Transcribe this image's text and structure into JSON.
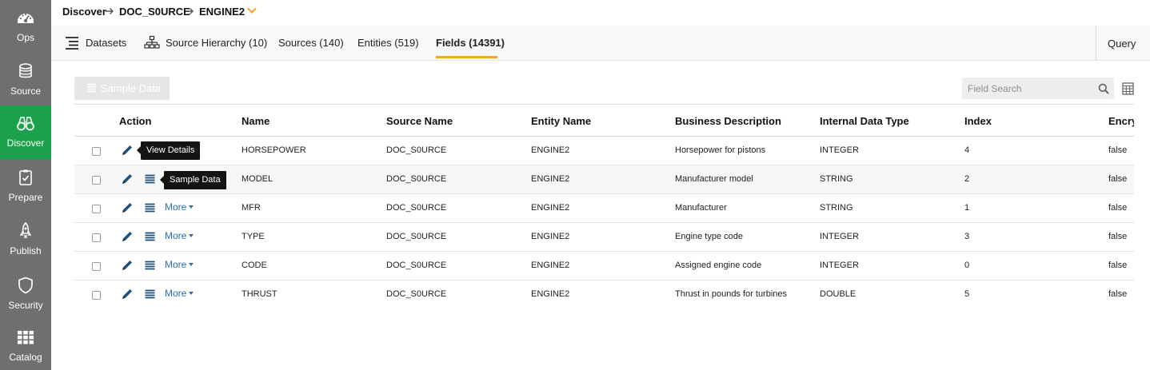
{
  "sidebar": {
    "items": [
      {
        "label": "Ops",
        "icon": "gauge-icon",
        "active": false
      },
      {
        "label": "Source",
        "icon": "database-icon",
        "active": false
      },
      {
        "label": "Discover",
        "icon": "binoculars-icon",
        "active": true
      },
      {
        "label": "Prepare",
        "icon": "clipboard-icon",
        "active": false
      },
      {
        "label": "Publish",
        "icon": "rocket-icon",
        "active": false
      },
      {
        "label": "Security",
        "icon": "shield-icon",
        "active": false
      },
      {
        "label": "Catalog",
        "icon": "grid-icon",
        "active": false
      }
    ],
    "background": "#6f6f6f",
    "active_color": "#1aa34a"
  },
  "breadcrumb": {
    "items": [
      "Discover",
      "DOC_S0URCE",
      "ENGINE2"
    ],
    "caret_color": "#f5a623"
  },
  "tabs": {
    "items": [
      {
        "label": "Datasets",
        "icon": "list-icon"
      },
      {
        "label": "Source Hierarchy (10)",
        "icon": "hierarchy-icon"
      },
      {
        "label": "Sources (140)"
      },
      {
        "label": "Entities (519)"
      },
      {
        "label": "Fields (14391)",
        "active": true
      }
    ],
    "query_label": "Query",
    "underline_color": "#f5a623"
  },
  "toolbar": {
    "sample_data_label": "Sample Data",
    "search_placeholder": "Field Search"
  },
  "table": {
    "columns": [
      "Action",
      "Name",
      "Source Name",
      "Entity Name",
      "Business Description",
      "Internal Data Type",
      "Index",
      "Encry"
    ],
    "more_label": "More",
    "rows": [
      {
        "name": "HORSEPOWER",
        "source": "DOC_S0URCE",
        "entity": "ENGINE2",
        "description": "Horsepower for pistons",
        "type": "INTEGER",
        "index": "4",
        "encrypted": "false"
      },
      {
        "name": "MODEL",
        "source": "DOC_S0URCE",
        "entity": "ENGINE2",
        "description": "Manufacturer model",
        "type": "STRING",
        "index": "2",
        "encrypted": "false"
      },
      {
        "name": "MFR",
        "source": "DOC_S0URCE",
        "entity": "ENGINE2",
        "description": "Manufacturer",
        "type": "STRING",
        "index": "1",
        "encrypted": "false"
      },
      {
        "name": "TYPE",
        "source": "DOC_S0URCE",
        "entity": "ENGINE2",
        "description": "Engine type code",
        "type": "INTEGER",
        "index": "3",
        "encrypted": "false"
      },
      {
        "name": "CODE",
        "source": "DOC_S0URCE",
        "entity": "ENGINE2",
        "description": "Assigned engine code",
        "type": "INTEGER",
        "index": "0",
        "encrypted": "false"
      },
      {
        "name": "THRUST",
        "source": "DOC_S0URCE",
        "entity": "ENGINE2",
        "description": "Thrust in pounds for turbines",
        "type": "DOUBLE",
        "index": "5",
        "encrypted": "false"
      }
    ]
  },
  "tooltips": {
    "view_details": "View Details",
    "sample_data": "Sample Data"
  },
  "colors": {
    "link": "#2a6fb0",
    "icon_blue": "#1f4f7a"
  }
}
